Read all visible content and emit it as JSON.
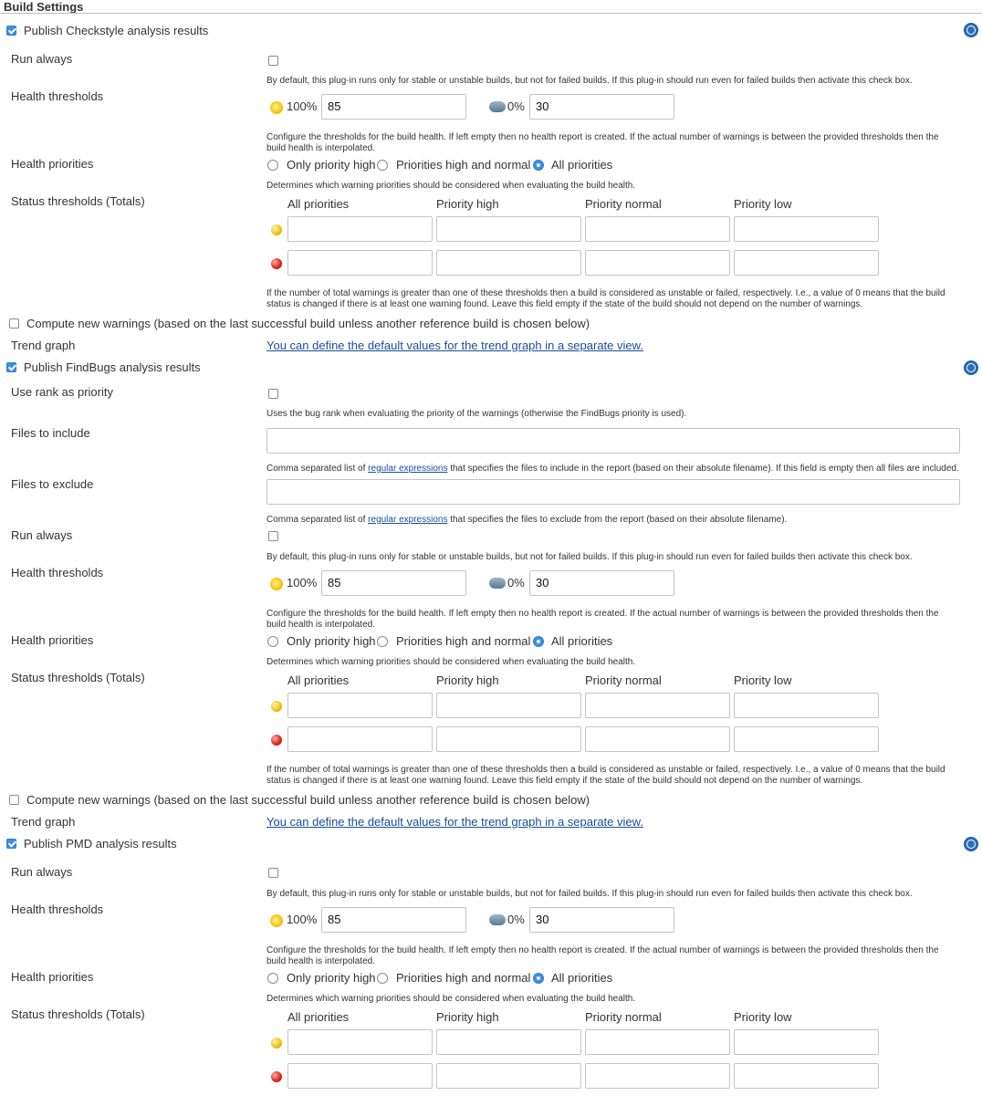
{
  "title": "Build Settings",
  "help_symbol": "?",
  "texts": {
    "run_always": "Run always",
    "run_always_desc": "By default, this plug-in runs only for stable or unstable builds, but not for failed builds. If this plug-in should run even for failed builds then activate this check box.",
    "health_thresholds": "Health thresholds",
    "healthy_pct": "100%",
    "unhealthy_pct": "0%",
    "healthy_value": "85",
    "unhealthy_value": "30",
    "health_desc_1": "Configure the thresholds for the build health. If left empty then no health report is created. If the actual number of warnings is between the provided thresholds then the",
    "health_desc_2": "build health is interpolated.",
    "health_priorities": "Health priorities",
    "only_priority_high": "Only priority high",
    "priorities_high_normal": "Priorities high and normal",
    "all_priorities": "All priorities",
    "health_priorities_desc": "Determines which warning priorities should be considered when evaluating the build health.",
    "status_thresholds": "Status thresholds (Totals)",
    "col_all": "All priorities",
    "col_high": "Priority high",
    "col_normal": "Priority normal",
    "col_low": "Priority low",
    "status_desc_1": "If the number of total warnings is greater than one of these thresholds then a build is considered as unstable or failed, respectively. I.e., a value of 0 means that the build",
    "status_desc_2": "status is changed if there is at least one warning found. Leave this field empty if the state of the build should not depend on the number of warnings.",
    "compute_new": "Compute new warnings (based on the last successful build unless another reference build is chosen below)",
    "trend_graph": "Trend graph",
    "trend_link": "You can define the default values for the trend graph in a separate view.",
    "use_rank": "Use rank as priority",
    "use_rank_desc": "Uses the bug rank when evaluating the priority of the warnings (otherwise the FindBugs priority is used).",
    "files_include": "Files to include",
    "files_exclude": "Files to exclude",
    "comma_prefix": "Comma separated list of",
    "regex_link": "regular expressions",
    "include_suffix": "that specifies the files to include in the report (based on their absolute filename). If this field is empty then all files are included.",
    "exclude_suffix": "that specifies the files to exclude from the report (based on their absolute filename)."
  },
  "plugins": [
    {
      "label": "Publish Checkstyle analysis results",
      "checked": true
    },
    {
      "label": "Publish FindBugs analysis results",
      "checked": true
    },
    {
      "label": "Publish PMD analysis results",
      "checked": true
    }
  ],
  "colors": {
    "link": "#1b4d9b",
    "checkbox": "#3a8ee6",
    "help": "#2a6fb7"
  }
}
